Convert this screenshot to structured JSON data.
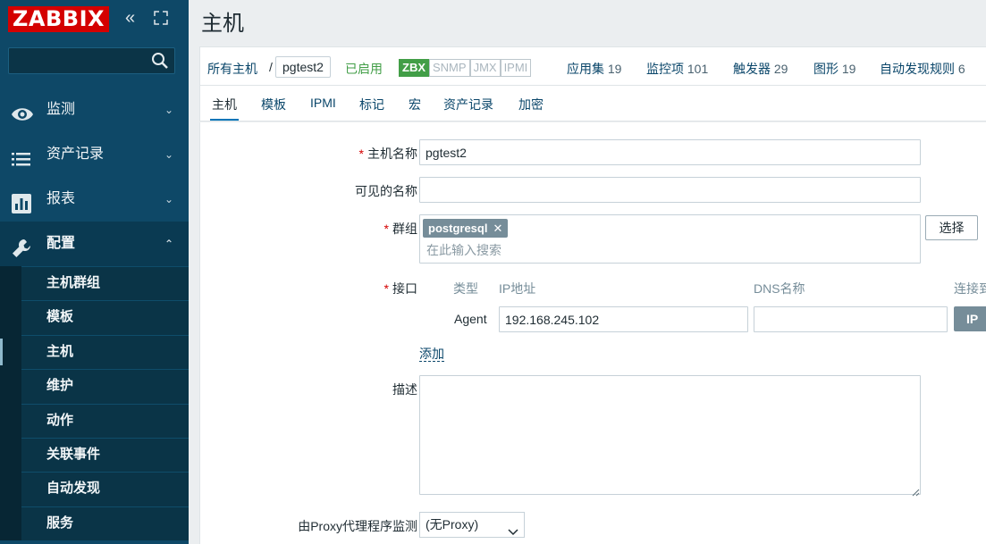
{
  "brand": {
    "logo": "ZABBIX",
    "color": "#d40000"
  },
  "sidebar": {
    "search_value": "",
    "menu": [
      {
        "label": "监测",
        "icon": "eye-icon"
      },
      {
        "label": "资产记录",
        "icon": "list-icon"
      },
      {
        "label": "报表",
        "icon": "bar-chart-icon"
      },
      {
        "label": "配置",
        "icon": "wrench-icon"
      }
    ],
    "submenu": [
      "主机群组",
      "模板",
      "主机",
      "维护",
      "动作",
      "关联事件",
      "自动发现",
      "服务"
    ]
  },
  "page": {
    "title": "主机"
  },
  "crumbs": {
    "all_hosts": "所有主机",
    "separator": "/",
    "current": "pgtest2",
    "status": "已启用",
    "availability": [
      "ZBX",
      "SNMP",
      "JMX",
      "IPMI"
    ],
    "links": [
      {
        "label": "应用集",
        "count": "19"
      },
      {
        "label": "监控项",
        "count": "101"
      },
      {
        "label": "触发器",
        "count": "29"
      },
      {
        "label": "图形",
        "count": "19"
      },
      {
        "label": "自动发现规则",
        "count": "6"
      }
    ]
  },
  "tabs": [
    "主机",
    "模板",
    "IPMI",
    "标记",
    "宏",
    "资产记录",
    "加密"
  ],
  "form": {
    "required_mark": "*",
    "host_name_label": "主机名称",
    "host_name_value": "pgtest2",
    "visible_name_label": "可见的名称",
    "visible_name_value": "",
    "groups_label": "群组",
    "group_tag": "postgresql",
    "groups_placeholder": "在此输入搜索",
    "select_button": "选择",
    "interfaces_label": "接口",
    "interface_headers": {
      "type": "类型",
      "ip": "IP地址",
      "dns": "DNS名称",
      "connect": "连接到"
    },
    "interface": {
      "type": "Agent",
      "ip": "192.168.245.102",
      "dns": "",
      "connect_ip": "IP"
    },
    "add_link": "添加",
    "description_label": "描述",
    "description_value": "",
    "proxy_label": "由Proxy代理程序监测",
    "proxy_value": "(无Proxy)"
  }
}
